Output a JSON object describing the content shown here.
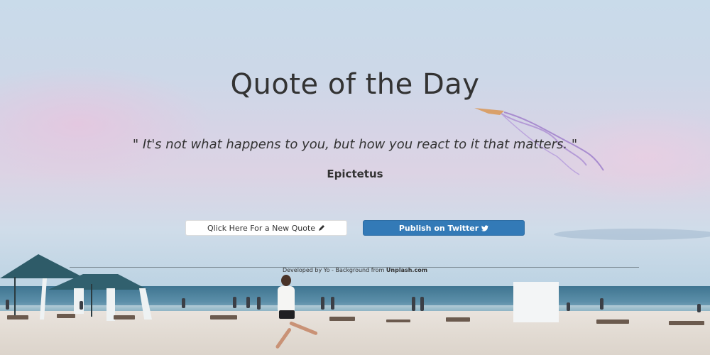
{
  "title": "Quote of the Day",
  "quote": "\" It's not what happens to you, but how you react to it that matters. \"",
  "author": "Epictetus",
  "buttons": {
    "new_quote_label": "Qlick Here For a New Quote",
    "new_quote_icon": "pencil-icon",
    "twitter_label": "Publish on Twitter",
    "twitter_icon": "twitter-icon"
  },
  "footer": {
    "prefix": "Developed by Yo - Background from ",
    "link": "Unplash.com"
  },
  "colors": {
    "text": "#333333",
    "twitter_button": "#337ab7",
    "new_quote_button": "#ffffff"
  }
}
